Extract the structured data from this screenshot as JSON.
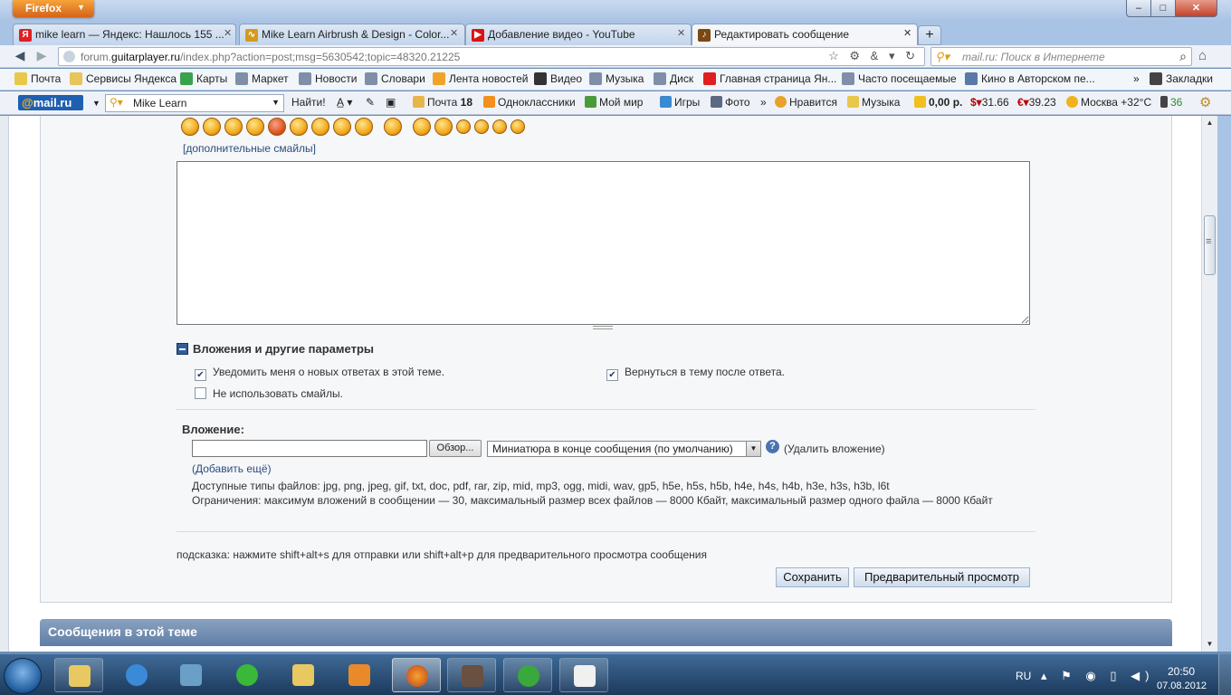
{
  "window": {
    "firefox_label": "Firefox",
    "controls": {
      "minimize": "–",
      "maximize": "□",
      "close": "✕"
    }
  },
  "tabs": [
    {
      "label": "mike learn — Яндекс: Нашлось 155 ...",
      "icon": "yandex-icon",
      "color": "#e02020"
    },
    {
      "label": "Mike Learn Airbrush & Design - Color...",
      "icon": "site-icon",
      "color": "#d49a1e"
    },
    {
      "label": "Добавление видео - YouTube",
      "icon": "youtube-icon",
      "color": "#d11"
    },
    {
      "label": "Редактировать сообщение",
      "icon": "guitar-icon",
      "color": "#7a4a12",
      "active": true
    }
  ],
  "new_tab_label": "+",
  "nav": {
    "url_prefix": "forum.",
    "url_domain": "guitarplayer.ru",
    "url_rest": "/index.php?action=post;msg=5630542;topic=48320.21225",
    "search_placeholder": "mail.ru: Поиск в Интернете"
  },
  "bookmarks": [
    {
      "label": "Почта",
      "color": "#e0b33a"
    },
    {
      "label": "Сервисы Яндекса",
      "color": "#e8c45a"
    },
    {
      "label": "Карты",
      "color": "#3aa24a"
    },
    {
      "label": "Маркет",
      "color": "#7f8fa8"
    },
    {
      "label": "Новости",
      "color": "#7f8fa8"
    },
    {
      "label": "Словари",
      "color": "#7f8fa8"
    },
    {
      "label": "Лента новостей",
      "color": "#f0a22a"
    },
    {
      "label": "Видео",
      "color": "#333"
    },
    {
      "label": "Музыка",
      "color": "#7f8fa8"
    },
    {
      "label": "Диск",
      "color": "#7f8fa8"
    },
    {
      "label": "Главная страница Ян...",
      "color": "#e02020"
    },
    {
      "label": "Часто посещаемые",
      "color": "#7f8fa8"
    },
    {
      "label": "Кино в Авторском пе...",
      "color": "#5a78a8"
    }
  ],
  "bookmarks_overflow": "»",
  "bookmarks_menu": "Закладки",
  "mailbar": {
    "logo": "mail.ru",
    "search_value": "Mike Learn",
    "find_label": "Найти!",
    "mail_label": "Почта",
    "mail_count": "18",
    "ok_label": "Одноклассники",
    "myworld_label": "Мой мир",
    "games_label": "Игры",
    "photo_label": "Фото",
    "likes_label": "Нравится",
    "music_label": "Музыка",
    "balance": "0,00 р.",
    "usd": "31.66",
    "eur": "39.23",
    "weather": "Москва +32°C",
    "traffic": "36"
  },
  "form": {
    "more_smileys": "[дополнительные смайлы]",
    "message_text": "",
    "attachments_header": "Вложения и другие параметры",
    "notify_label": "Уведомить меня о новых ответах в этой теме.",
    "notify_checked": true,
    "return_label": "Вернуться в тему после ответа.",
    "return_checked": true,
    "nosmiley_label": "Не использовать смайлы.",
    "nosmiley_checked": false,
    "attachment_label": "Вложение:",
    "browse_label": "Обзор...",
    "thumb_option": "Миниатюра в конце сообщения (по умолчанию)",
    "help": "?",
    "remove_attachment": "(Удалить вложение)",
    "add_more": "(Добавить ещё)",
    "allowed_types": "Доступные типы файлов: jpg, png, jpeg, gif, txt, doc, pdf, rar, zip, mid, mp3, ogg, midi, wav, gp5, h5e, h5s, h5b, h4e, h4s, h4b, h3e, h3s, h3b, l6t",
    "limits": "Ограничения: максимум вложений в сообщении — 30, максимальный размер всех файлов — 8000 Кбайт, максимальный размер одного файла — 8000 Кбайт",
    "hint": "подсказка: нажмите shift+alt+s для отправки или shift+alt+p для предварительного просмотра сообщения",
    "save_label": "Сохранить",
    "preview_label": "Предварительный просмотр"
  },
  "topic_messages_header": "Сообщения в этой теме",
  "taskbar": {
    "apps": [
      "explorer-icon",
      "ie-icon",
      "chart-app-icon",
      "flower-app-icon",
      "folder-icon",
      "media-player-icon",
      "firefox-icon",
      "image-app-icon",
      "utorrent-icon",
      "notepad-icon"
    ],
    "lang": "RU",
    "time": "20:50",
    "date": "07.08.2012"
  }
}
